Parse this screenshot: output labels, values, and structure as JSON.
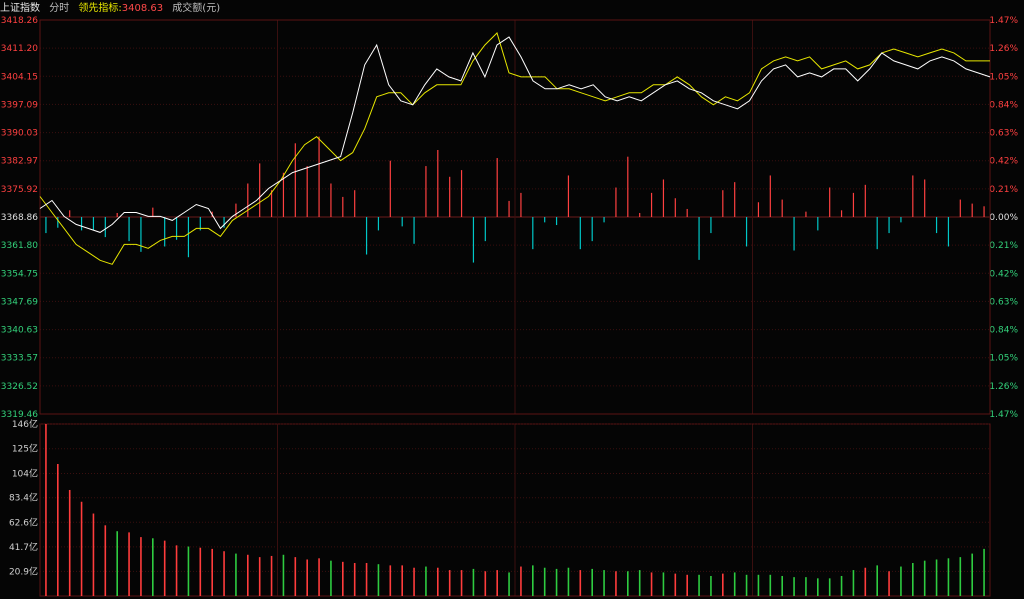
{
  "header": {
    "index_name": "上证指数",
    "mode": "分时",
    "leading_label": "领先指标:",
    "leading_value": "3408.63",
    "volume_label": "成交额(元)"
  },
  "colors": {
    "background": "#050505",
    "grid": "#3a0f0f",
    "up": "#ff4040",
    "down": "#00c8c8",
    "white_line": "#ffffff",
    "yellow_line": "#e6e600",
    "vol_up": "#ff3c3c",
    "vol_down": "#2ecc40",
    "zero_label": "#e0e0e0"
  },
  "price_axis": {
    "labels": [
      "3418.26",
      "3411.20",
      "3404.15",
      "3397.09",
      "3390.03",
      "3382.97",
      "3375.92",
      "3368.86",
      "3361.80",
      "3354.75",
      "3347.69",
      "3340.63",
      "3333.57",
      "3326.52",
      "3319.46"
    ],
    "pct_labels": [
      "1.47%",
      "1.26%",
      "1.05%",
      "0.84%",
      "0.63%",
      "0.42%",
      "0.21%",
      "0.00%",
      "0.21%",
      "0.42%",
      "0.63%",
      "0.84%",
      "1.05%",
      "1.26%",
      "1.47%"
    ],
    "base_index": 7
  },
  "volume_axis": {
    "labels": [
      "146亿",
      "125亿",
      "104亿",
      "83.4亿",
      "62.6亿",
      "41.7亿",
      "20.9亿"
    ]
  },
  "chart_data": {
    "type": "line",
    "base": 3368.86,
    "ylim": [
      3319.46,
      3418.26
    ],
    "white_line": [
      3371,
      3373,
      3369,
      3367,
      3366,
      3365,
      3367,
      3370,
      3370,
      3369,
      3369,
      3368,
      3370,
      3372,
      3371,
      3366,
      3369,
      3371,
      3373,
      3376,
      3378,
      3380,
      3381,
      3382,
      3383,
      3384,
      3395,
      3407,
      3412,
      3402,
      3398,
      3397,
      3402,
      3406,
      3404,
      3403,
      3410,
      3404,
      3412,
      3414,
      3409,
      3403,
      3401,
      3401,
      3402,
      3401,
      3402,
      3399,
      3398,
      3399,
      3398,
      3400,
      3402,
      3403,
      3401,
      3400,
      3398,
      3397,
      3396,
      3398,
      3403,
      3406,
      3407,
      3404,
      3405,
      3404,
      3406,
      3406,
      3403,
      3406,
      3410,
      3408,
      3407,
      3406,
      3408,
      3409,
      3408,
      3406,
      3405,
      3404
    ],
    "yellow_line": [
      3374,
      3370,
      3366,
      3362,
      3360,
      3358,
      3357,
      3362,
      3362,
      3361,
      3363,
      3364,
      3364,
      3366,
      3366,
      3364,
      3368,
      3370,
      3372,
      3374,
      3378,
      3383,
      3387,
      3389,
      3386,
      3383,
      3385,
      3391,
      3399,
      3400,
      3400,
      3397,
      3400,
      3402,
      3402,
      3402,
      3408,
      3412,
      3415,
      3405,
      3404,
      3404,
      3404,
      3401,
      3401,
      3400,
      3399,
      3398,
      3399,
      3400,
      3400,
      3402,
      3402,
      3404,
      3402,
      3399,
      3397,
      3399,
      3398,
      3400,
      3406,
      3408,
      3409,
      3408,
      3409,
      3406,
      3407,
      3408,
      3406,
      3407,
      3410,
      3411,
      3410,
      3409,
      3410,
      3411,
      3410,
      3408,
      3408,
      3408
    ],
    "breadth_bars": [
      -0.12,
      -0.08,
      0.05,
      -0.1,
      -0.1,
      -0.15,
      0.03,
      -0.18,
      -0.26,
      0.07,
      -0.22,
      -0.17,
      -0.3,
      -0.1,
      0.04,
      -0.08,
      0.1,
      0.25,
      0.4,
      0.2,
      0.33,
      0.55,
      0.38,
      0.6,
      0.25,
      0.15,
      0.2,
      -0.28,
      -0.1,
      0.42,
      -0.07,
      -0.2,
      0.38,
      0.5,
      0.3,
      0.35,
      -0.34,
      -0.18,
      0.44,
      0.12,
      0.18,
      -0.24,
      -0.04,
      -0.06,
      0.31,
      -0.24,
      -0.18,
      -0.04,
      0.22,
      0.45,
      0.03,
      0.18,
      0.28,
      0.14,
      0.06,
      -0.32,
      -0.12,
      0.2,
      0.26,
      -0.22,
      0.11,
      0.31,
      0.13,
      -0.25,
      0.04,
      -0.1,
      0.22,
      0.05,
      0.18,
      0.24,
      -0.24,
      -0.12,
      -0.04,
      0.31,
      0.28,
      -0.12,
      -0.22,
      0.13,
      0.1,
      0.08
    ],
    "volumes": [
      146,
      112,
      90,
      80,
      70,
      60,
      55,
      54,
      50,
      49,
      47,
      43,
      42,
      41,
      40,
      38,
      36,
      35,
      33,
      34,
      35,
      33,
      31,
      32,
      30,
      29,
      28,
      28,
      27,
      26,
      26,
      24,
      25,
      24,
      22,
      22,
      23,
      21,
      22,
      20,
      25,
      26,
      24,
      23,
      24,
      22,
      23,
      22,
      21,
      21,
      22,
      20,
      20,
      19,
      18,
      18,
      17,
      19,
      20,
      18,
      18,
      18,
      17,
      16,
      16,
      15,
      15,
      17,
      22,
      24,
      26,
      21,
      25,
      28,
      30,
      31,
      32,
      33,
      36,
      40
    ],
    "volume_colors": [
      "up",
      "up",
      "up",
      "up",
      "up",
      "up",
      "down",
      "up",
      "up",
      "down",
      "up",
      "up",
      "down",
      "up",
      "up",
      "up",
      "down",
      "up",
      "up",
      "up",
      "down",
      "up",
      "up",
      "up",
      "down",
      "up",
      "up",
      "up",
      "down",
      "up",
      "up",
      "up",
      "down",
      "up",
      "up",
      "up",
      "down",
      "up",
      "up",
      "down",
      "up",
      "down",
      "down",
      "down",
      "down",
      "up",
      "down",
      "down",
      "up",
      "down",
      "down",
      "up",
      "down",
      "up",
      "up",
      "down",
      "down",
      "up",
      "down",
      "down",
      "down",
      "down",
      "down",
      "down",
      "down",
      "down",
      "down",
      "down",
      "down",
      "up",
      "down",
      "up",
      "down",
      "down",
      "down",
      "down",
      "down",
      "down",
      "down",
      "down"
    ]
  }
}
